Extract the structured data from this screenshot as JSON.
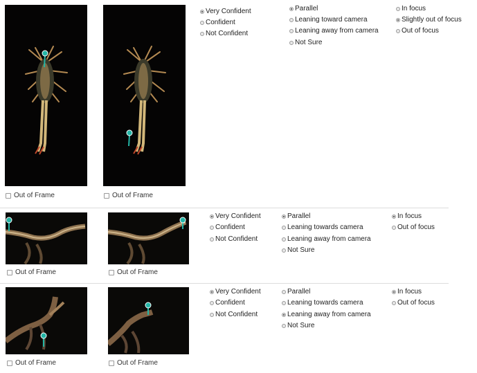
{
  "checkbox_label": "Out of Frame",
  "pairs": [
    {
      "confidence": [
        "Very Confident",
        "Confident",
        "Not Confident"
      ],
      "confidence_selected": 0,
      "orientation": [
        "Parallel",
        "Leaning toward camera",
        "Leaning away from camera",
        "Not Sure"
      ],
      "orientation_selected": 0,
      "focus": [
        "In focus",
        "Slightly out of focus",
        "Out of focus"
      ],
      "focus_selected": 1
    },
    {
      "confidence": [
        "Very Confident",
        "Confident",
        "Not Confident"
      ],
      "confidence_selected": 0,
      "orientation": [
        "Parallel",
        "Leaning towards camera",
        "Leaning away from camera",
        "Not Sure"
      ],
      "orientation_selected": 0,
      "focus": [
        "In focus",
        "Out of focus"
      ],
      "focus_selected": 0
    },
    {
      "confidence": [
        "Very Confident",
        "Confident",
        "Not Confident"
      ],
      "confidence_selected": 0,
      "orientation": [
        "Parallel",
        "Leaning towards camera",
        "Leaning away from camera",
        "Not Sure"
      ],
      "orientation_selected": 2,
      "focus": [
        "In focus",
        "Out of focus"
      ],
      "focus_selected": 0
    }
  ],
  "colors": {
    "marker": "#23b5a6",
    "background": "#050404"
  }
}
